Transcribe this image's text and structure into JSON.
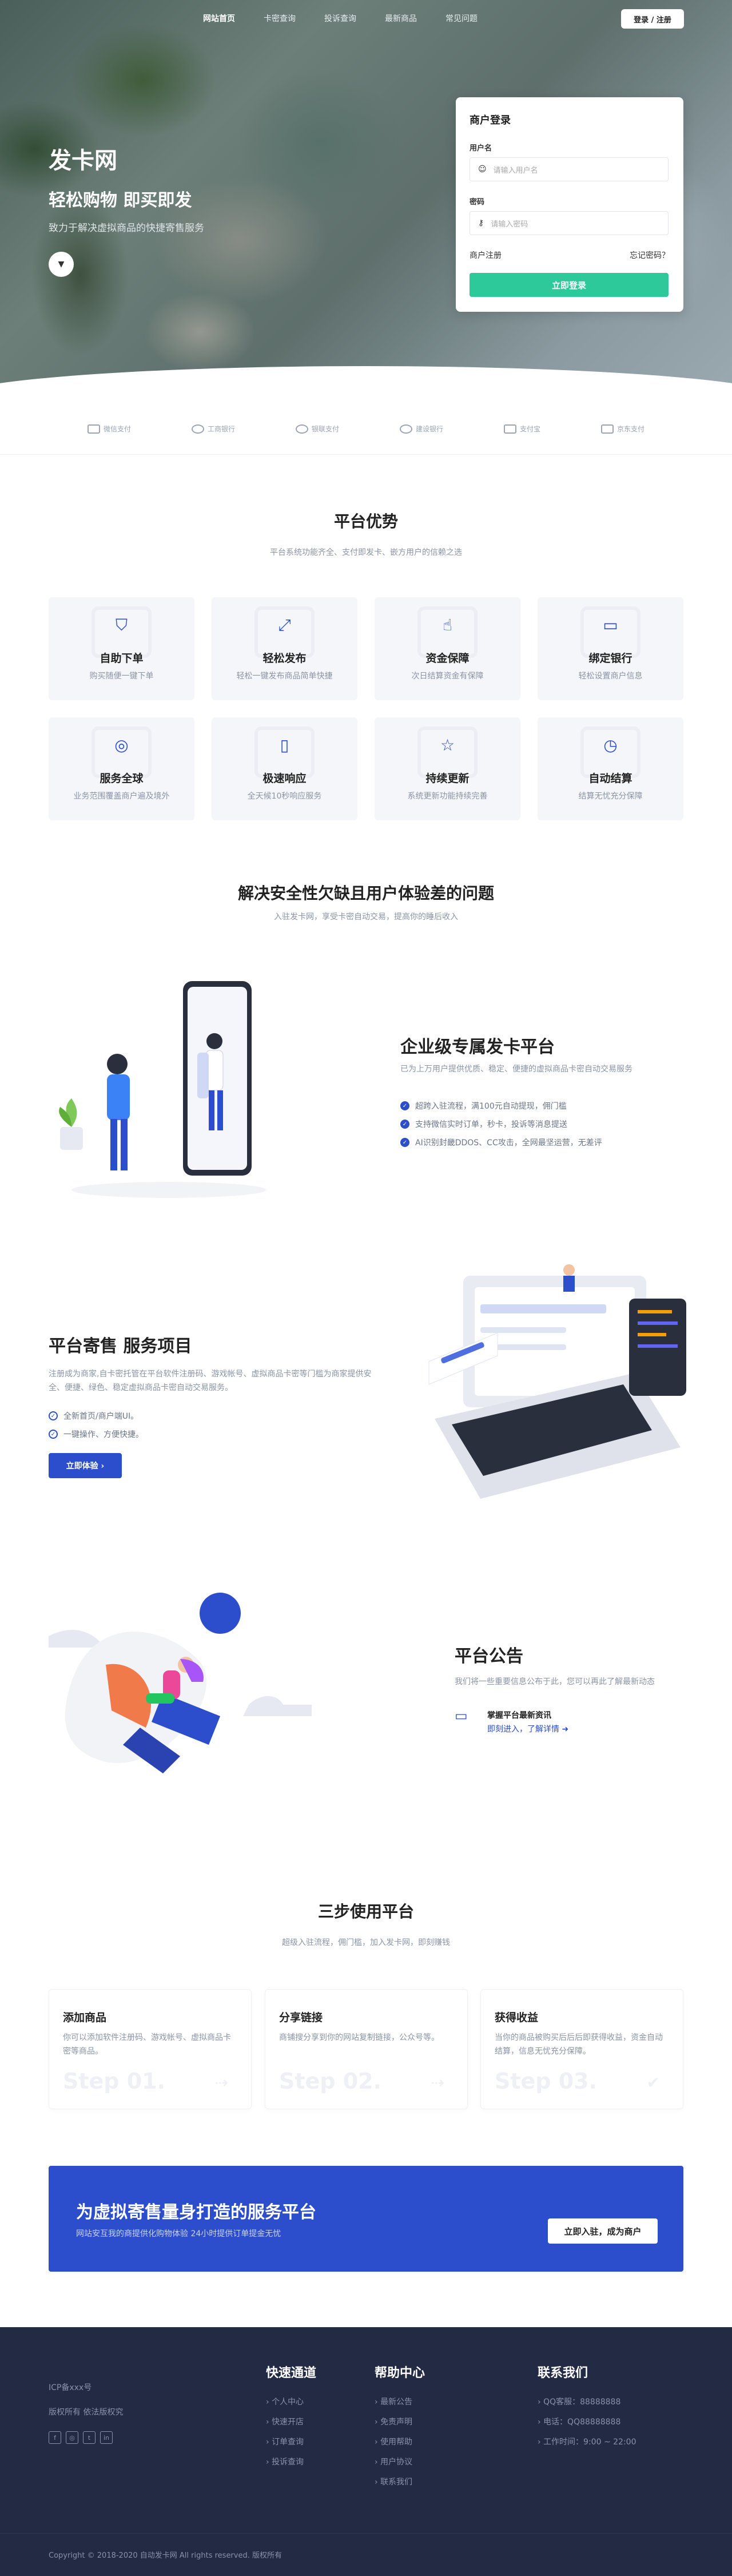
{
  "nav": {
    "items": [
      "网站首页",
      "卡密查询",
      "投诉查询",
      "最新商品",
      "常见问题"
    ],
    "login": "登录 / 注册"
  },
  "hero": {
    "title": "发卡网",
    "subtitle": "轻松购物 即买即发",
    "desc": "致力于解决虚拟商品的快捷寄售服务"
  },
  "login": {
    "title": "商户登录",
    "user_label": "用户名",
    "user_ph": "请输入用户名",
    "pass_label": "密码",
    "pass_ph": "请输入密码",
    "register": "商户注册",
    "forgot": "忘记密码？",
    "submit": "立即登录"
  },
  "partners": [
    "微信支付",
    "工商银行",
    "银联支付",
    "建设银行",
    "支付宝",
    "京东支付"
  ],
  "adv": {
    "title": "平台优势",
    "desc": "平台系统功能齐全、支付即发卡、嵌方用户的信赖之选",
    "cards": [
      {
        "icon": "shield-check-icon",
        "t": "自助下单",
        "d": "购买随便一键下单"
      },
      {
        "icon": "expand-icon",
        "t": "轻松发布",
        "d": "轻松一键发布商品简单快捷"
      },
      {
        "icon": "thumbs-up-icon",
        "t": "资金保障",
        "d": "次日结算资金有保障"
      },
      {
        "icon": "card-icon",
        "t": "绑定银行",
        "d": "轻松设置商户信息"
      },
      {
        "icon": "globe-icon",
        "t": "服务全球",
        "d": "业务范围覆盖商户遍及境外"
      },
      {
        "icon": "bookmark-icon",
        "t": "极速响应",
        "d": "全天候10秒响应服务"
      },
      {
        "icon": "star-icon",
        "t": "持续更新",
        "d": "系统更新功能持续完善"
      },
      {
        "icon": "clock-icon",
        "t": "自动结算",
        "d": "结算无忧充分保障"
      }
    ]
  },
  "problem": {
    "title": "解决安全性欠缺且用户体验差的问题",
    "desc": "入驻发卡网，享受卡密自动交易，提高你的睡后收入"
  },
  "enterprise": {
    "title": "企业级专属发卡平台",
    "desc": "已为上万用户提供优质、稳定、便捷的虚拟商品卡密自动交易服务",
    "checks": [
      "超跨入驻流程，满100元自动提现，佣门槛",
      "支持微信实时订单，秒卡，投诉等消息提送",
      "AI识别封畿DDOS、CC攻击，全网最坚运营，无差评"
    ]
  },
  "consign": {
    "title": "平台寄售 服务项目",
    "desc": "注册成为商家,自卡密托管在平台软件注册码、游戏帐号、虚拟商品卡密等门槛为商家提供安全、便捷、绿色、稳定虚拟商品卡密自动交易服务。",
    "checks": [
      "全新首页/商户端UI。",
      "一键操作、方便快捷。"
    ],
    "btn": "立即体验 ›"
  },
  "notice": {
    "title": "平台公告",
    "desc": "我们将一些重要信息公布于此，您可以再此了解最新动态",
    "item_title": "掌握平台最新资讯",
    "item_link": "即刻进入，了解详情 ➜"
  },
  "steps": {
    "title": "三步使用平台",
    "desc": "超级入驻流程，佣门槛，加入发卡网，即刻赚钱",
    "items": [
      {
        "t": "添加商品",
        "d": "你可以添加软件注册码、游戏帐号、虚拟商品卡密等商品。",
        "n": "Step 01.",
        "mk": "⇢"
      },
      {
        "t": "分享链接",
        "d": "商铺搜分享到你的网站复制链接，公众号等。",
        "n": "Step 02.",
        "mk": "⇢"
      },
      {
        "t": "获得收益",
        "d": "当你的商品被购买后后后即获得收益，资金自动结算，信息无忧充分保障。",
        "n": "Step 03.",
        "mk": "✔"
      }
    ]
  },
  "cta": {
    "title": "为虚拟寄售量身打造的服务平台",
    "desc": "网站安互我的商提供化购物体验 24小时提供订单提金无忧",
    "btn": "立即入驻，成为商户"
  },
  "footer": {
    "icp": "ICP备xxx号",
    "rights": "版权所有 依法版权究",
    "social": [
      "f",
      "◎",
      "t",
      "in"
    ],
    "col1": {
      "title": "快速通道",
      "items": [
        "个人中心",
        "快速开店",
        "订单查询",
        "投诉查询"
      ]
    },
    "col2": {
      "title": "帮助中心",
      "items": [
        "最新公告",
        "免责声明",
        "使用帮助",
        "用户协议",
        "联系我们"
      ]
    },
    "col3": {
      "title": "联系我们",
      "items": [
        "QQ客服：88888888",
        "电话：QQ88888888",
        "工作时间：9:00 ~ 22:00"
      ]
    },
    "copyright": "Copyright © 2018-2020 自动发卡网 All rights reserved. 版权所有"
  },
  "colors": {
    "primary": "#2c4dcc",
    "green": "#2dc99a",
    "footer": "#232a44"
  }
}
